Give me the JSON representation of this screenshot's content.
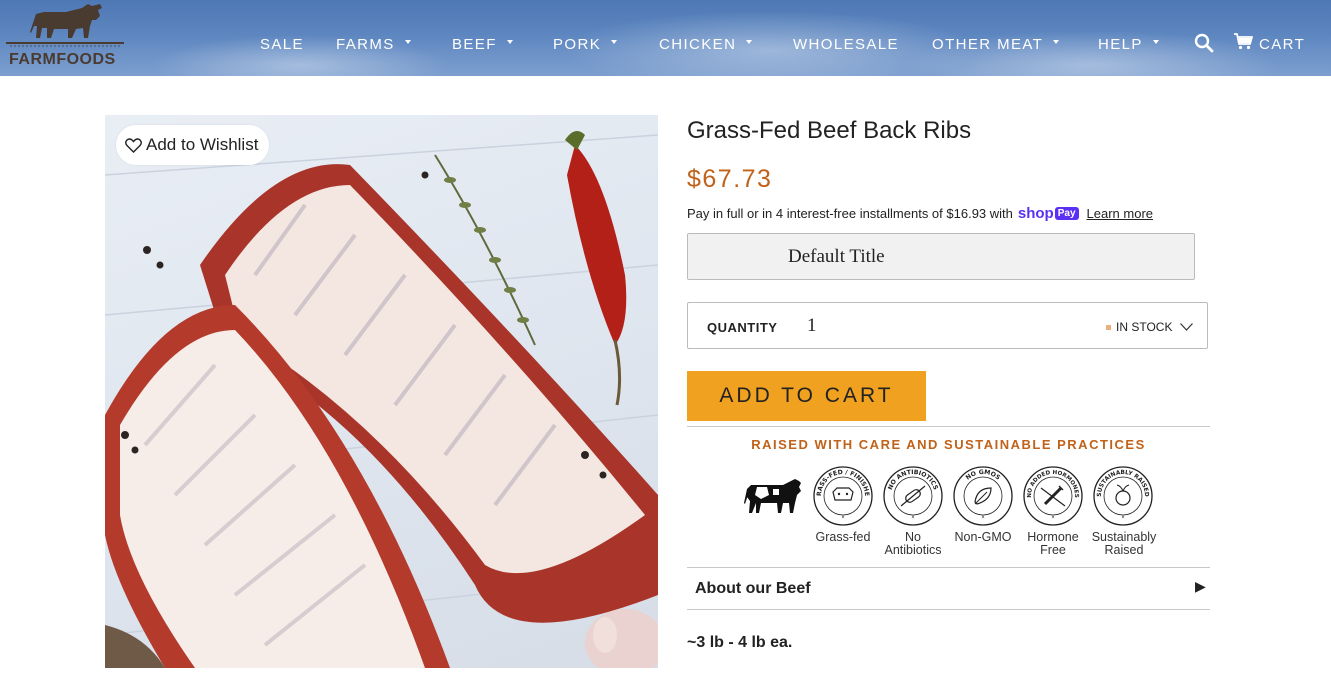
{
  "header": {
    "logo_text": "FARMFOODS",
    "nav": [
      {
        "label": "SALE",
        "has_dropdown": false
      },
      {
        "label": "FARMS",
        "has_dropdown": true
      },
      {
        "label": "BEEF",
        "has_dropdown": true
      },
      {
        "label": "PORK",
        "has_dropdown": true
      },
      {
        "label": "CHICKEN",
        "has_dropdown": true
      },
      {
        "label": "WHOLESALE",
        "has_dropdown": false
      },
      {
        "label": "OTHER MEAT",
        "has_dropdown": true
      },
      {
        "label": "HELP",
        "has_dropdown": true
      }
    ],
    "cart_label": "CART",
    "icons": [
      "search-icon",
      "cart-icon"
    ]
  },
  "product": {
    "wishlist_label": "Add to Wishlist",
    "title": "Grass-Fed Beef Back Ribs",
    "price": "$67.73",
    "installments": {
      "text": "Pay in full or in 4 interest-free installments of $16.93 with",
      "shop_text": "shop",
      "pay_badge": "Pay",
      "learn_more": "Learn more"
    },
    "variant": "Default Title",
    "quantity_label": "QUANTITY",
    "quantity_value": "1",
    "stock_status": "IN STOCK",
    "add_to_cart": "ADD TO CART",
    "practices_heading": "RAISED WITH CARE AND SUSTAINABLE PRACTICES",
    "badges": [
      {
        "ring_text": "GRASS-FED / FINISHED",
        "label_line1": "Grass-fed",
        "label_line2": ""
      },
      {
        "ring_text": "NO ANTIBIOTICS",
        "label_line1": "No",
        "label_line2": "Antibiotics"
      },
      {
        "ring_text": "NO GMOS",
        "label_line1": "Non-GMO",
        "label_line2": ""
      },
      {
        "ring_text": "NO ADDED HORMONES",
        "label_line1": "Hormone",
        "label_line2": "Free"
      },
      {
        "ring_text": "SUSTAINABLY RAISED",
        "label_line1": "Sustainably",
        "label_line2": "Raised"
      }
    ],
    "about_label": "About our Beef",
    "about_arrow": "▶",
    "weight": "~3 lb - 4 lb ea."
  },
  "colors": {
    "accent_orange": "#c0621a",
    "button_orange": "#f0a11f",
    "header_blue": "#5d86c0",
    "shop_purple": "#5a31f4"
  }
}
